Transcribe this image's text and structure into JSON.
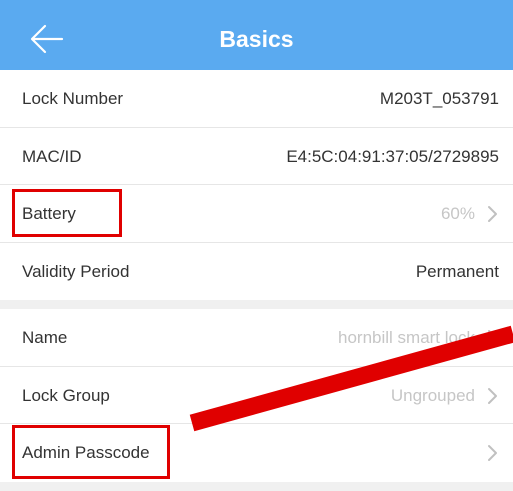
{
  "header": {
    "title": "Basics",
    "back_icon": "arrow-left-icon",
    "background": "#5aaaf0"
  },
  "basics": {
    "lock_number": {
      "label": "Lock Number",
      "value": "M203T_053791"
    },
    "mac_id": {
      "label": "MAC/ID",
      "value": "E4:5C:04:91:37:05/2729895"
    },
    "battery": {
      "label": "Battery",
      "value": "60%"
    },
    "validity": {
      "label": "Validity Period",
      "value": "Permanent"
    }
  },
  "settings": {
    "name": {
      "label": "Name",
      "value": "hornbill smart lock"
    },
    "lock_group": {
      "label": "Lock Group",
      "value": "Ungrouped"
    },
    "admin_passcode": {
      "label": "Admin Passcode",
      "value": ""
    }
  },
  "annotation_color": "#e00000"
}
